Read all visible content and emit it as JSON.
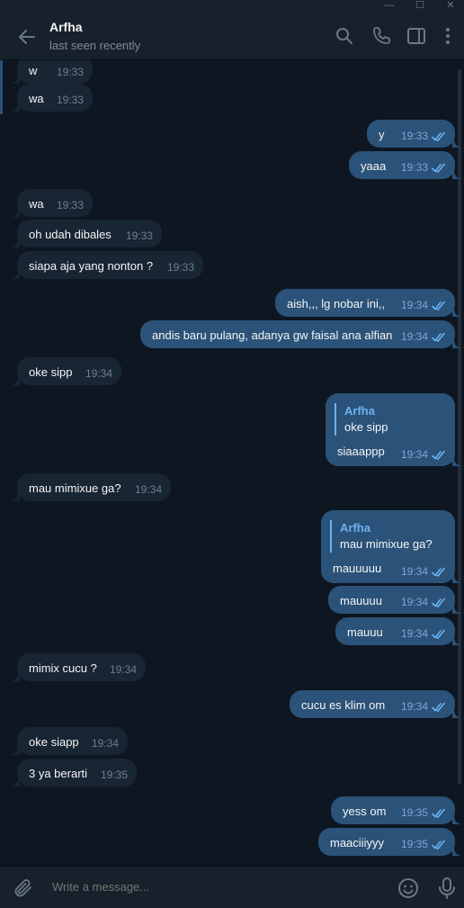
{
  "window": {
    "min_glyph": "—",
    "max_glyph": "☐",
    "close_glyph": "✕"
  },
  "header": {
    "name": "Arfha",
    "status": "last seen recently"
  },
  "messages": [
    {
      "dir": "in",
      "text": "w",
      "time": "19:33"
    },
    {
      "dir": "in",
      "text": "wa",
      "time": "19:33"
    },
    {
      "dir": "out",
      "text": "y",
      "time": "19:33"
    },
    {
      "dir": "out",
      "text": "yaaa",
      "time": "19:33"
    },
    {
      "dir": "in",
      "text": "wa",
      "time": "19:33"
    },
    {
      "dir": "in",
      "text": "oh udah dibales",
      "time": "19:33"
    },
    {
      "dir": "in",
      "text": "siapa aja yang nonton ?",
      "time": "19:33"
    },
    {
      "dir": "out",
      "text": "aish,,,  lg nobar ini,,",
      "time": "19:34"
    },
    {
      "dir": "out",
      "text": "andis baru pulang, adanya gw faisal ana alfian",
      "time": "19:34"
    },
    {
      "dir": "in",
      "text": "oke sipp",
      "time": "19:34"
    },
    {
      "dir": "out",
      "text": "siaaappp",
      "time": "19:34",
      "reply_name": "Arfha",
      "reply_text": "oke sipp"
    },
    {
      "dir": "in",
      "text": "mau mimixue ga?",
      "time": "19:34"
    },
    {
      "dir": "out",
      "text": "mauuuuu",
      "time": "19:34",
      "reply_name": "Arfha",
      "reply_text": "mau mimixue ga?"
    },
    {
      "dir": "out",
      "text": "mauuuu",
      "time": "19:34"
    },
    {
      "dir": "out",
      "text": "mauuu",
      "time": "19:34"
    },
    {
      "dir": "in",
      "text": "mimix cucu ?",
      "time": "19:34"
    },
    {
      "dir": "out",
      "text": "cucu es klim om",
      "time": "19:34"
    },
    {
      "dir": "in",
      "text": "oke siapp",
      "time": "19:34"
    },
    {
      "dir": "in",
      "text": "3 ya berarti",
      "time": "19:35"
    },
    {
      "dir": "out",
      "text": "yess om",
      "time": "19:35"
    },
    {
      "dir": "out",
      "text": "maaciiiyyy",
      "time": "19:35"
    }
  ],
  "composer": {
    "placeholder": "Write a message..."
  },
  "icons": {
    "back": "back-arrow-icon",
    "search": "search-icon",
    "call": "phone-icon",
    "sidebar": "sidebar-toggle-icon",
    "more": "more-vertical-icon",
    "attach": "paperclip-icon",
    "emoji": "emoji-icon",
    "mic": "microphone-icon",
    "read": "double-check-icon"
  },
  "colors": {
    "background": "#0e1621",
    "panel": "#17212b",
    "incoming": "#182533",
    "outgoing": "#2b5278",
    "accent": "#6ab3f3",
    "muted": "#7f8b96"
  }
}
